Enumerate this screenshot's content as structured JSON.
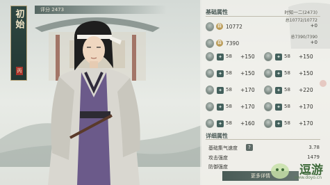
{
  "character": {
    "name_vertical": "初始",
    "subtitle_vertical": "…",
    "seal": "丙"
  },
  "score": {
    "label": "评分",
    "value": "2473"
  },
  "basic_attrs": {
    "title": "基础属性",
    "time_label": "时知一二(2473)",
    "resources": [
      {
        "badge": "白",
        "value": "10772",
        "meta": "总10772/10772",
        "plus": "+0"
      },
      {
        "badge": "白",
        "value": "7390",
        "meta": "总7390/7390",
        "plus": "+0"
      }
    ],
    "stats": [
      {
        "value": "58",
        "bonus": "+150"
      },
      {
        "value": "58",
        "bonus": "+150"
      },
      {
        "value": "58",
        "bonus": "+150"
      },
      {
        "value": "58",
        "bonus": "+150"
      },
      {
        "value": "58",
        "bonus": "+170"
      },
      {
        "value": "58",
        "bonus": "+220"
      },
      {
        "value": "58",
        "bonus": "+170"
      },
      {
        "value": "58",
        "bonus": "+170"
      },
      {
        "value": "58",
        "bonus": "+160"
      },
      {
        "value": "58",
        "bonus": "+170"
      }
    ]
  },
  "detail_attrs": {
    "title": "详细属性",
    "rows": [
      {
        "label": "基础集气速度",
        "value": "3.78",
        "help": "?"
      },
      {
        "label": "攻击强度",
        "value": "1479"
      },
      {
        "label": "防御强度",
        "value": ""
      }
    ]
  },
  "more_button": "更多详情",
  "watermark": {
    "text": "逗游",
    "sub": "www.doyo.cn"
  },
  "colors": {
    "banner": "#2f4741",
    "panel_accent": "#43605c",
    "badge": "#b99a55",
    "seal": "#a8352c"
  }
}
